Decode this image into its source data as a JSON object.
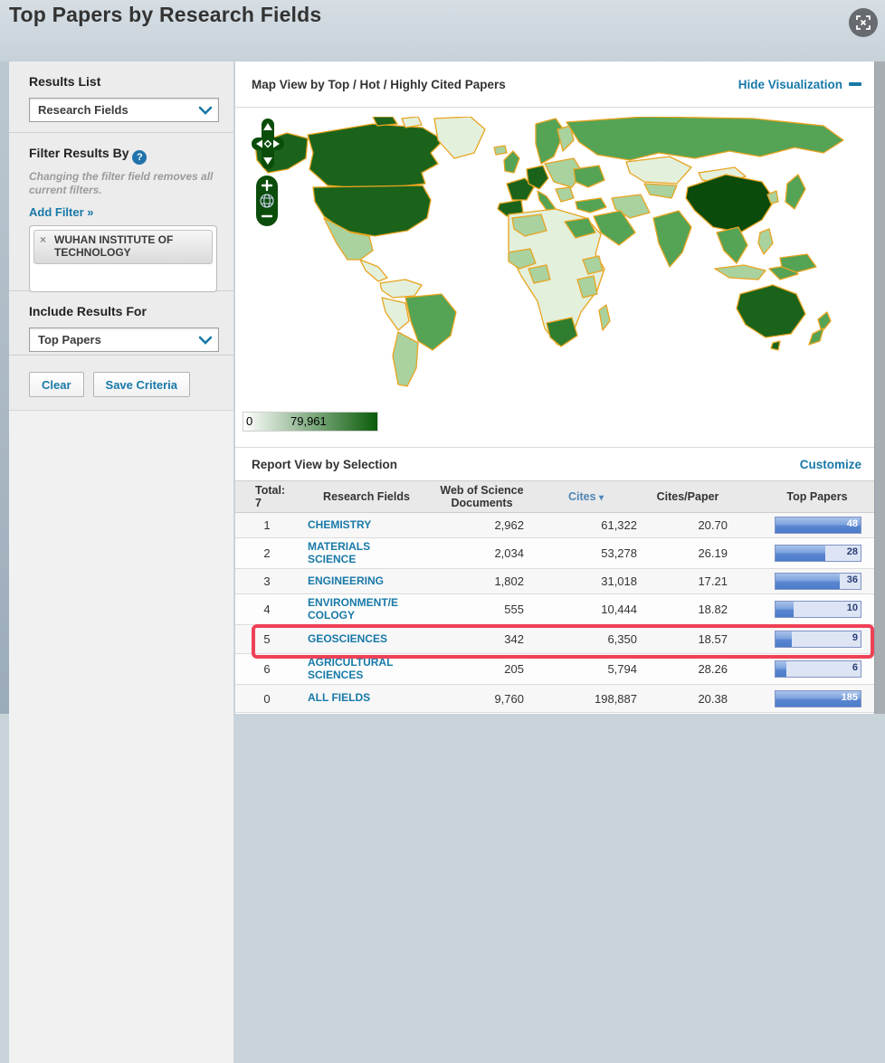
{
  "colors": {
    "accent_teal": "#1879a8",
    "highlight_red": "#ef4156",
    "legend_dark": "#0a5c0a",
    "map_border": "#e9a41f",
    "map_l1": "#e3f0dc",
    "map_l2": "#a9d29e",
    "map_l3": "#55a355",
    "map_l3b": "#2f7d2f",
    "map_l4": "#1b631b",
    "map_l5": "#0a4a0a",
    "bar_bg": "#dde4f4",
    "bar_border": "#8094c4",
    "pan_green": "#0b4d0b"
  },
  "page": {
    "title": "Top Papers by Research Fields"
  },
  "sidebar": {
    "results_list": {
      "label": "Results List",
      "selected": "Research Fields"
    },
    "filter": {
      "heading": "Filter Results By",
      "help": "?",
      "note": "Changing the filter field removes all current filters.",
      "add_filter_label": "Add Filter »",
      "tag": {
        "remove": "×",
        "label": "WUHAN INSTITUTE OF TECHNOLOGY"
      }
    },
    "include_results": {
      "label": "Include Results For",
      "selected": "Top Papers"
    },
    "buttons": {
      "clear": "Clear",
      "save": "Save Criteria"
    }
  },
  "map_section": {
    "title": "Map View by Top / Hot / Highly Cited Papers",
    "hide_label": "Hide Visualization",
    "legend": {
      "min": "0",
      "max": "79,961"
    },
    "shade_levels": [
      "none",
      "very-low",
      "low",
      "medium",
      "high",
      "highest"
    ]
  },
  "report": {
    "title": "Report View by Selection",
    "customize_label": "Customize",
    "table": {
      "total_label": "Total:",
      "total_value": "7",
      "columns": [
        "Research Fields",
        "Web of Science Documents",
        "Cites",
        "Cites/Paper",
        "Top Papers"
      ],
      "sort_indicator": "▾",
      "bar_max": 48,
      "rows": [
        {
          "rank": "1",
          "field": "CHEMISTRY",
          "docs": "2,962",
          "cites": "61,322",
          "cpp": "20.70",
          "top_papers": 48,
          "top_papers_label": "48"
        },
        {
          "rank": "2",
          "field": "MATERIALS SCIENCE",
          "docs": "2,034",
          "cites": "53,278",
          "cpp": "26.19",
          "top_papers": 28,
          "top_papers_label": "28"
        },
        {
          "rank": "3",
          "field": "ENGINEERING",
          "docs": "1,802",
          "cites": "31,018",
          "cpp": "17.21",
          "top_papers": 36,
          "top_papers_label": "36"
        },
        {
          "rank": "4",
          "field": "ENVIRONMENT/E COLOGY",
          "docs": "555",
          "cites": "10,444",
          "cpp": "18.82",
          "top_papers": 10,
          "top_papers_label": "10"
        },
        {
          "rank": "5",
          "field": "GEOSCIENCES",
          "docs": "342",
          "cites": "6,350",
          "cpp": "18.57",
          "top_papers": 9,
          "top_papers_label": "9",
          "highlighted": true
        },
        {
          "rank": "6",
          "field": "AGRICULTURAL SCIENCES",
          "docs": "205",
          "cites": "5,794",
          "cpp": "28.26",
          "top_papers": 6,
          "top_papers_label": "6"
        },
        {
          "rank": "0",
          "field": "ALL FIELDS",
          "docs": "9,760",
          "cites": "198,887",
          "cpp": "20.38",
          "top_papers": 185,
          "top_papers_label": "185"
        }
      ]
    }
  }
}
